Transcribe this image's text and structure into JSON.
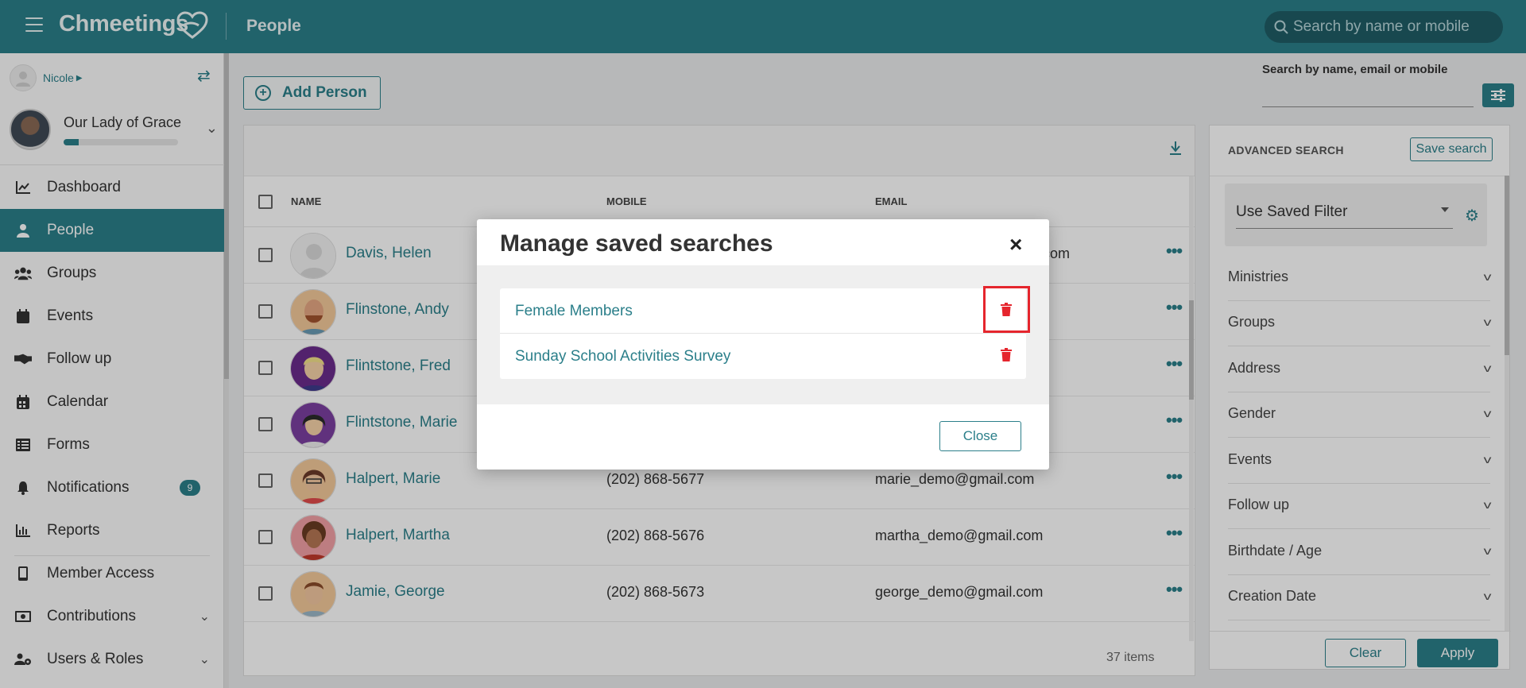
{
  "topbar": {
    "brand": "Chmeetings",
    "page_title": "People",
    "search_placeholder": "Search by name or mobile"
  },
  "sidebar": {
    "user_name": "Nicole",
    "church_name": "Our Lady of Grace",
    "church_progress": 0.13,
    "items": [
      {
        "label": "Dashboard",
        "icon": "chart-icon"
      },
      {
        "label": "People",
        "icon": "person-icon"
      },
      {
        "label": "Groups",
        "icon": "group-icon"
      },
      {
        "label": "Events",
        "icon": "calendar-icon"
      },
      {
        "label": "Follow up",
        "icon": "handshake-icon"
      },
      {
        "label": "Calendar",
        "icon": "calendar-grid-icon"
      },
      {
        "label": "Forms",
        "icon": "list-icon"
      },
      {
        "label": "Notifications",
        "icon": "bell-icon",
        "badge": "9"
      },
      {
        "label": "Reports",
        "icon": "bar-chart-icon"
      },
      {
        "label": "Member Access",
        "icon": "phone-icon"
      },
      {
        "label": "Contributions",
        "icon": "money-icon"
      },
      {
        "label": "Users & Roles",
        "icon": "users-cog-icon"
      }
    ]
  },
  "main": {
    "add_person_label": "Add Person",
    "columns": {
      "name": "NAME",
      "mobile": "MOBILE",
      "email": "EMAIL"
    },
    "rows": [
      {
        "name": "Davis, Helen",
        "mobile": "",
        "email": ".com"
      },
      {
        "name": "Flinstone, Andy",
        "mobile": "",
        "email": ""
      },
      {
        "name": "Flintstone, Fred",
        "mobile": "",
        "email": ""
      },
      {
        "name": "Flintstone, Marie",
        "mobile": "",
        "email": ""
      },
      {
        "name": "Halpert, Marie",
        "mobile": "(202) 868-5677",
        "email": "marie_demo@gmail.com"
      },
      {
        "name": "Halpert, Martha",
        "mobile": "(202) 868-5676",
        "email": "martha_demo@gmail.com"
      },
      {
        "name": "Jamie, George",
        "mobile": "(202) 868-5673",
        "email": "george_demo@gmail.com"
      }
    ],
    "items_count": "37 items"
  },
  "right_panel": {
    "search_label": "Search by name, email or mobile",
    "advanced_title": "ADVANCED SEARCH",
    "save_search_label": "Save search",
    "saved_filter_label": "Use Saved Filter",
    "accordions": [
      "Ministries",
      "Groups",
      "Address",
      "Gender",
      "Events",
      "Follow up",
      "Birthdate / Age",
      "Creation Date"
    ],
    "clear_label": "Clear",
    "apply_label": "Apply"
  },
  "modal": {
    "title": "Manage saved searches",
    "close_symbol": "×",
    "saved_searches": [
      "Female Members",
      "Sunday School Activities Survey"
    ],
    "close_label": "Close"
  },
  "colors": {
    "primary": "#2b7f8a",
    "delete": "#e5252d"
  }
}
